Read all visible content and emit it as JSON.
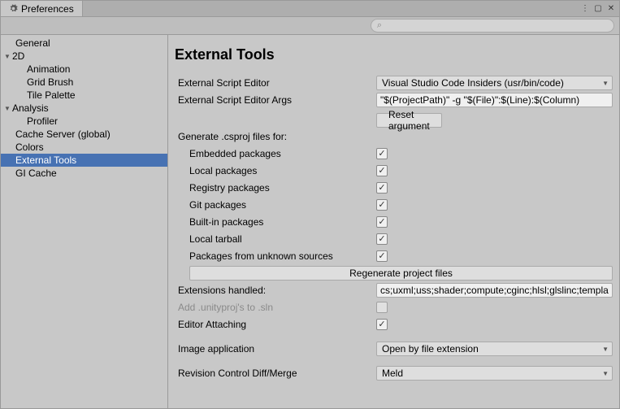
{
  "window": {
    "title": "Preferences"
  },
  "search": {
    "placeholder": ""
  },
  "sidebar": {
    "items": [
      {
        "label": "General"
      },
      {
        "label": "2D"
      },
      {
        "label": "Animation"
      },
      {
        "label": "Grid Brush"
      },
      {
        "label": "Tile Palette"
      },
      {
        "label": "Analysis"
      },
      {
        "label": "Profiler"
      },
      {
        "label": "Cache Server (global)"
      },
      {
        "label": "Colors"
      },
      {
        "label": "External Tools"
      },
      {
        "label": "GI Cache"
      }
    ]
  },
  "main": {
    "title": "External Tools",
    "labels": {
      "ext_editor": "External Script Editor",
      "ext_args": "External Script Editor Args",
      "reset_btn": "Reset argument",
      "gen_header": "Generate .csproj files for:",
      "embedded": "Embedded packages",
      "local": "Local packages",
      "registry": "Registry packages",
      "git": "Git packages",
      "builtin": "Built-in packages",
      "tarball": "Local tarball",
      "unknown": "Packages from unknown sources",
      "regen_btn": "Regenerate project files",
      "ext_handled": "Extensions handled:",
      "add_proj": "Add .unityproj's to .sln",
      "editor_attach": "Editor Attaching",
      "image_app": "Image application",
      "rev_ctrl": "Revision Control Diff/Merge"
    },
    "values": {
      "ext_editor": "Visual Studio Code Insiders (usr/bin/code)",
      "ext_args": "\"$(ProjectPath)\" -g \"$(File)\":$(Line):$(Column)",
      "ext_handled": "cs;uxml;uss;shader;compute;cginc;hlsl;glslinc;template",
      "image_app": "Open by file extension",
      "rev_ctrl": "Meld"
    },
    "checks": {
      "embedded": true,
      "local": true,
      "registry": true,
      "git": true,
      "builtin": true,
      "tarball": true,
      "unknown": true,
      "add_proj": false,
      "editor_attach": true
    }
  },
  "icons": {
    "search_glyph": "⌕",
    "menu_glyph": "⋮",
    "detach_glyph": "▢",
    "close_glyph": "✕"
  }
}
